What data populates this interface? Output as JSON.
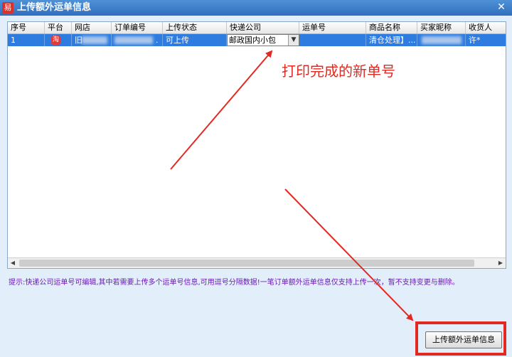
{
  "window": {
    "title": "上传额外运单信息",
    "app_icon": "易"
  },
  "grid": {
    "columns": [
      "序号",
      "平台",
      "网店",
      "订单编号",
      "上传状态",
      "快递公司",
      "运单号",
      "商品名称",
      "买家昵称",
      "收货人"
    ],
    "row": {
      "index": "1",
      "shop": "旧",
      "order_tail": ".",
      "status": "可上传",
      "courier": "邮政国内小包",
      "product": "清仓处理】...",
      "receiver": "许*"
    }
  },
  "hint": "提示:快递公司运单号可编辑,其中若需要上传多个运单号信息,可用逗号分隔数据!一笔订单额外运单信息仅支持上传一次，暂不支持变更与删除。",
  "button": {
    "upload": "上传额外运单信息"
  },
  "annotation": {
    "text": "打印完成的新单号"
  },
  "colors": {
    "accent_red": "#e32a22",
    "selection": "#2f7ce0",
    "hint": "#6a1ab4"
  }
}
